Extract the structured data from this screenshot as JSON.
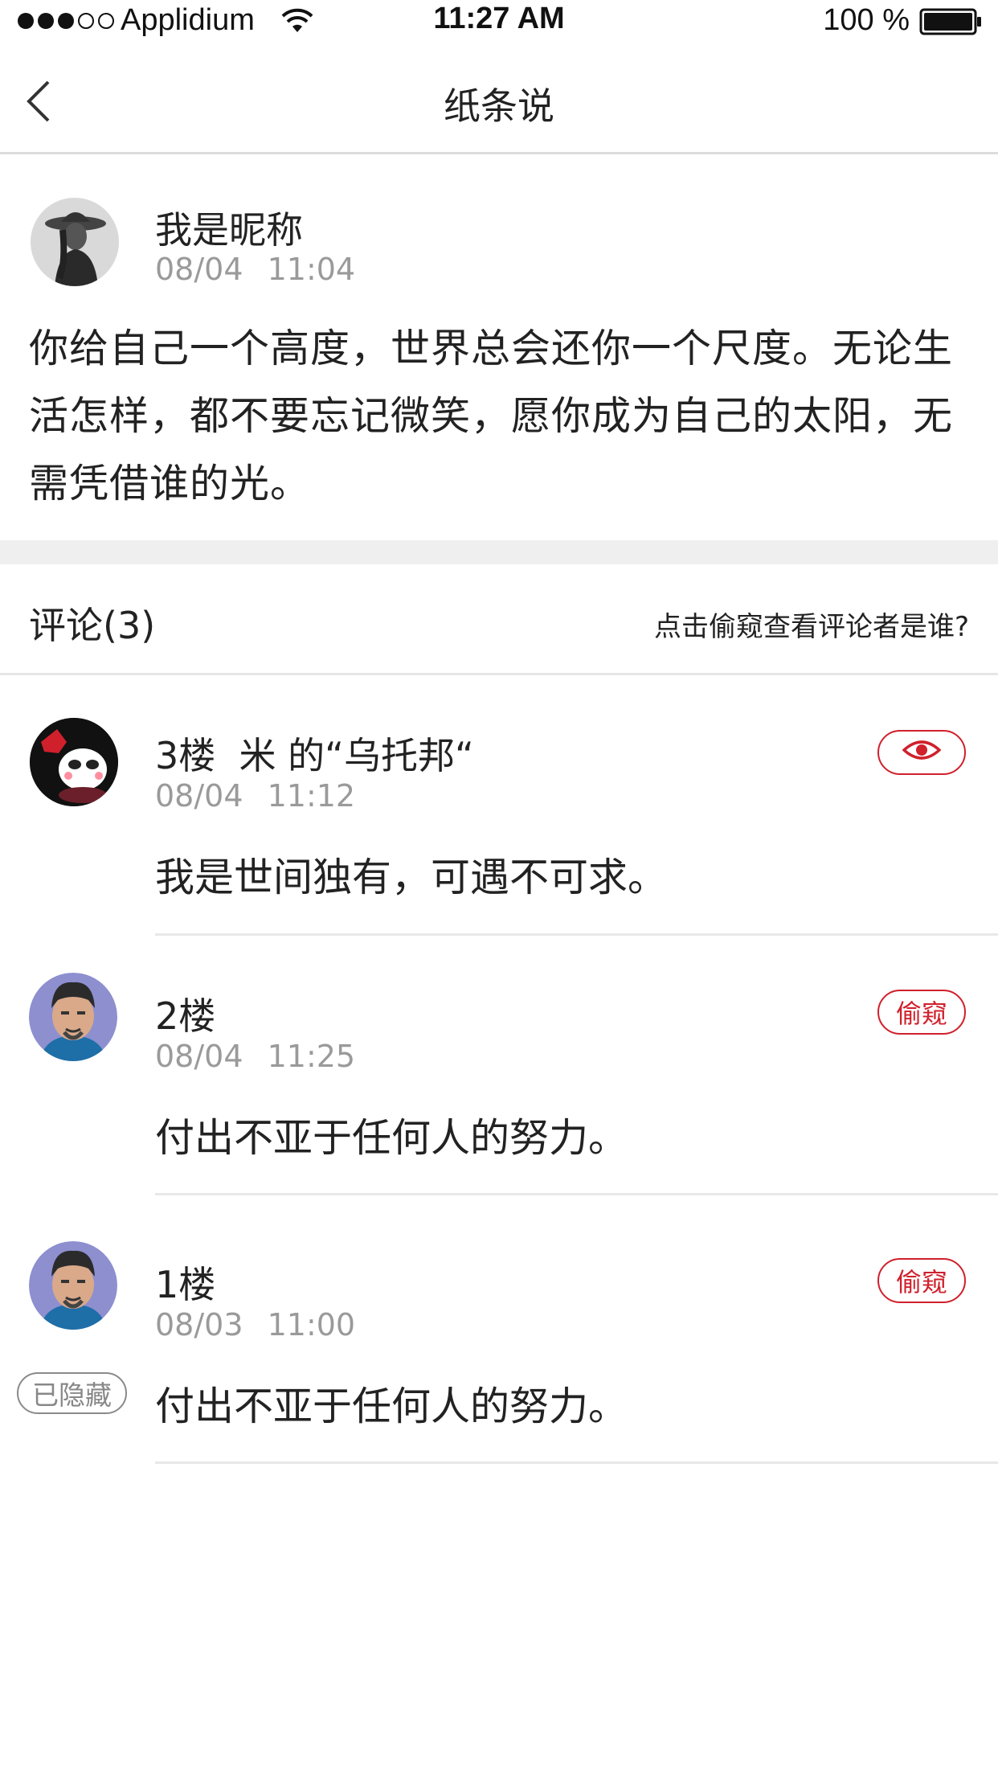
{
  "status_bar": {
    "carrier": "Applidium",
    "time": "11:27 AM",
    "battery": "100 %"
  },
  "nav": {
    "title": "纸条说"
  },
  "post": {
    "author": "我是昵称",
    "time": "08/04 11:04",
    "content": "你给自己一个高度，世界总会还你一个尺度。无论生活怎样，都不要忘记微笑，愿你成为自己的太阳，无需凭借谁的光。"
  },
  "comments_header": {
    "count_label": "评论(3)",
    "peek_hint": "点击偷窥查看评论者是谁?"
  },
  "comments": [
    {
      "name": "3楼  米 的“乌托邦“",
      "time": "08/04 11:12",
      "text": "我是世间独有，可遇不可求。",
      "action": "eye-icon"
    },
    {
      "name": "2楼",
      "time": "08/04 11:25",
      "text": "付出不亚于任何人的努力。",
      "action_label": "偷窥"
    },
    {
      "name": "1楼",
      "time": "08/03 11:00",
      "text": "付出不亚于任何人的努力。",
      "action_label": "偷窥",
      "hidden_label": "已隐藏"
    }
  ],
  "colors": {
    "accent": "#d0202c",
    "muted": "#9a9a9a",
    "divider": "#e8e8e8"
  }
}
